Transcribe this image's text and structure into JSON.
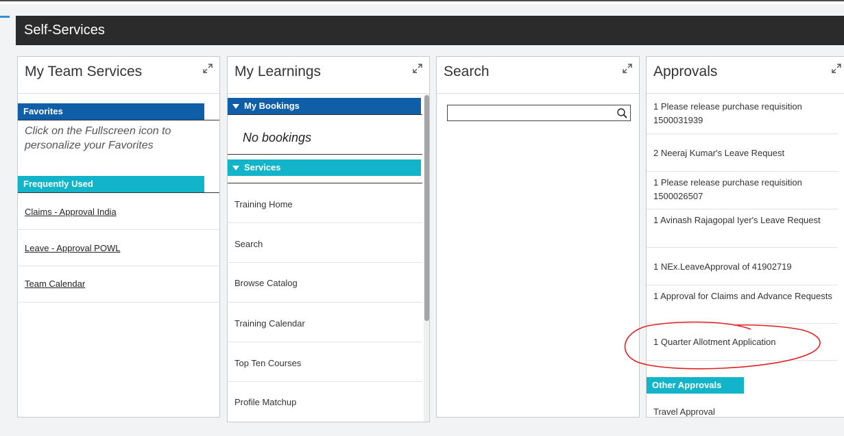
{
  "header": {
    "title": "Self-Services"
  },
  "team_services": {
    "title": "My Team Services",
    "favorites_label": "Favorites",
    "favorites_hint": "Click on the Fullscreen icon to personalize your Favorites",
    "frequently_used_label": "Frequently Used",
    "links": [
      "Claims - Approval India",
      "Leave - Approval POWL",
      "Team Calendar"
    ]
  },
  "learnings": {
    "title": "My Learnings",
    "bookings_label": "My Bookings",
    "no_bookings": "No bookings",
    "services_label": "Services",
    "items": [
      "Training Home",
      "Search",
      "Browse Catalog",
      "Training Calendar",
      "Top Ten Courses",
      "Profile Matchup"
    ]
  },
  "search": {
    "title": "Search",
    "input_value": ""
  },
  "approvals": {
    "title": "Approvals",
    "items": [
      "1 Please release purchase requisition 1500031939",
      "2 Neeraj Kumar's Leave Request",
      "1 Please release purchase requisition 1500026507",
      "1 Avinash Rajagopal Iyer's Leave Request",
      "1 NEx.LeaveApproval of 41902719",
      "1 Approval for Claims and Advance Requests",
      "1 Quarter Allotment Application"
    ],
    "other_label": "Other Approvals",
    "other_items": [
      "Travel Approval"
    ]
  },
  "colors": {
    "header_bg": "#2b2b2b",
    "blue_bar": "#0f5ea8",
    "teal_bar": "#11b4c8",
    "annotation": "#e02020"
  },
  "icons": {
    "expand": "expand-icon",
    "search": "search-icon",
    "collapse": "triangle-down-icon"
  }
}
